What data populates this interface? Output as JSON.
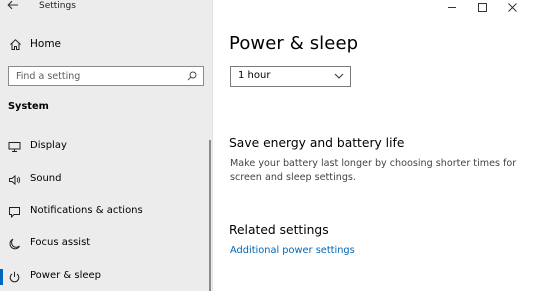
{
  "window": {
    "app_title": "Settings"
  },
  "nav": {
    "home_label": "Home",
    "search": {
      "placeholder": "Find a setting",
      "value": ""
    },
    "section_heading": "System",
    "items": [
      {
        "label": "Display",
        "icon": "monitor-icon",
        "selected": false
      },
      {
        "label": "Sound",
        "icon": "speaker-icon",
        "selected": false
      },
      {
        "label": "Notifications & actions",
        "icon": "notification-icon",
        "selected": false
      },
      {
        "label": "Focus assist",
        "icon": "moon-icon",
        "selected": false
      },
      {
        "label": "Power & sleep",
        "icon": "power-icon",
        "selected": true
      }
    ]
  },
  "main": {
    "title": "Power & sleep",
    "sleep_dropdown": {
      "value": "1 hour"
    },
    "save_energy": {
      "heading": "Save energy and battery life",
      "text": "Make your battery last longer by choosing shorter times for screen and sleep settings."
    },
    "related": {
      "heading": "Related settings",
      "link": "Additional power settings"
    }
  },
  "colors": {
    "accent": "#0067c0",
    "link": "#0067b8",
    "nav_background": "#ececec",
    "content_background": "#ffffff"
  }
}
